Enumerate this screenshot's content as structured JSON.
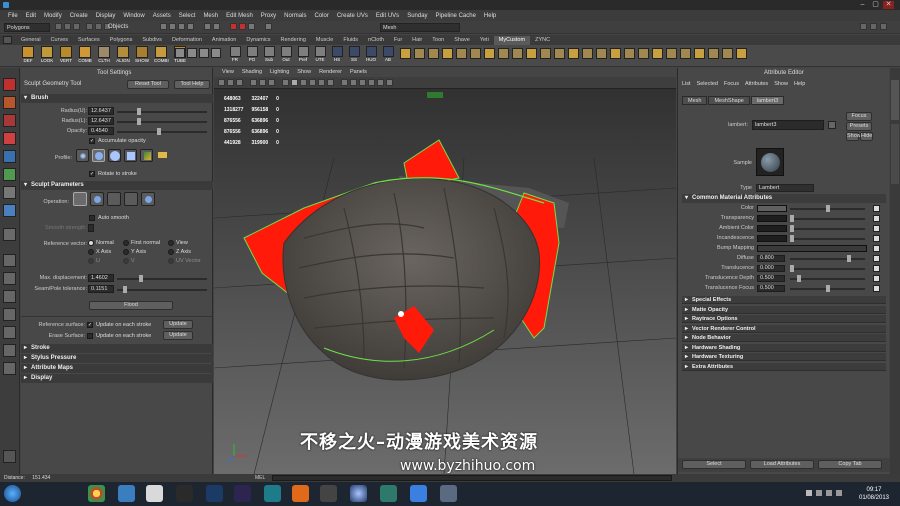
{
  "window": {
    "menus": [
      "File",
      "Edit",
      "Modify",
      "Create",
      "Display",
      "Window",
      "Assets",
      "Select",
      "Mesh",
      "Edit Mesh",
      "Proxy",
      "Normals",
      "Color",
      "Create UVs",
      "Edit UVs",
      "Sunday",
      "Pipeline Cache",
      "Help"
    ]
  },
  "statusline": {
    "mode": "Polygons",
    "objects_label": "Objects",
    "search_value": "Mesh"
  },
  "shelf": {
    "tabs": [
      "General",
      "Curves",
      "Surfaces",
      "Polygons",
      "Subdivs",
      "Deformation",
      "Animation",
      "Dynamics",
      "Rendering",
      "Muscle",
      "Fluids",
      "nCloth",
      "Fur",
      "Hair",
      "Toon",
      "Shave",
      "Yeti",
      "MyCustom",
      "ZYNC"
    ],
    "active_tab": "MyCustom",
    "left_labels": [
      "DEF",
      "LOOK",
      "VERT",
      "COMB",
      "CLTH",
      "ALIGN",
      "SHOW",
      "COMBI",
      "TUBE"
    ],
    "right_labels": [
      "FR",
      "PO",
      "Sub",
      "Out",
      "Pref",
      "UTE",
      "HS",
      "SS",
      "HUO",
      "AB"
    ]
  },
  "tool_settings": {
    "panel_title": "Tool Settings",
    "tool_name": "Sculpt Geometry Tool",
    "reset_tool": "Reset Tool",
    "tool_help": "Tool Help",
    "brush": {
      "header": "Brush",
      "radius_u_label": "Radius(U):",
      "radius_u": "12.6437",
      "radius_l_label": "Radius(L):",
      "radius_l": "12.6437",
      "opacity_label": "Opacity:",
      "opacity": "0.4540",
      "accumulate_opacity": "Accumulate opacity",
      "profile_label": "Profile:",
      "rotate_to_stroke": "Rotate to stroke"
    },
    "sculpt_parameters": {
      "header": "Sculpt Parameters",
      "operation_label": "Operation:",
      "auto_smooth": "Auto smooth",
      "smooth_strength_label": "Smooth strength:",
      "reference_vector_label": "Reference vector:",
      "options": [
        "Normal",
        "First normal",
        "View",
        "X Axis",
        "Y Axis",
        "Z Axis",
        "U",
        "V",
        "UV Vector"
      ],
      "max_displacement_label": "Max. displacement:",
      "max_displacement": "1.4602",
      "seam_pole_label": "Seam/Pole tolerance:",
      "seam_pole": "0.1151",
      "flood_label": "Flood"
    },
    "reference_surface_label": "Reference surface:",
    "erase_surface_label": "Erase Surface:",
    "update_on_each_stroke": "Update on each stroke",
    "update_button": "Update",
    "collapsed_sections": [
      "Stroke",
      "Stylus Pressure",
      "Attribute Maps",
      "Display"
    ]
  },
  "viewport": {
    "menus": [
      "View",
      "Shading",
      "Lighting",
      "Show",
      "Renderer",
      "Panels"
    ],
    "hud": [
      [
        "648063",
        "322407",
        "0"
      ],
      [
        "1318277",
        "956158",
        "0"
      ],
      [
        "876556",
        "636896",
        "0"
      ],
      [
        "876556",
        "636896",
        "0"
      ],
      [
        "441928",
        "319900",
        "0"
      ]
    ],
    "watermark_cn": "不移之火–动漫游戏美术资源",
    "watermark_url": "www.byzhihuo.com"
  },
  "attribute_editor": {
    "panel_title": "Attribute Editor",
    "menus": [
      "List",
      "Selected",
      "Focus",
      "Attributes",
      "Show",
      "Help"
    ],
    "node_tabs": [
      "Mesh",
      "MeshShape",
      "lambert3"
    ],
    "active_node_tab": "lambert3",
    "node_type_label": "lambert:",
    "node_name": "lambert3",
    "focus": "Focus",
    "presets": "Presets",
    "show": "Show",
    "hide": "Hide",
    "sample_label": "Sample",
    "type_label": "Type",
    "type_value": "Lambert",
    "common_header": "Common Material Attributes",
    "attrs": [
      {
        "label": "Color",
        "value": "",
        "slider": 0.5
      },
      {
        "label": "Transparency",
        "value": "",
        "slider": 0.0
      },
      {
        "label": "Ambient Color",
        "value": "",
        "slider": 0.0
      },
      {
        "label": "Incandescence",
        "value": "",
        "slider": 0.0
      },
      {
        "label": "Bump Mapping",
        "value": "",
        "slider": null
      },
      {
        "label": "Diffuse",
        "value": "0.800",
        "slider": 0.8
      },
      {
        "label": "Translucence",
        "value": "0.000",
        "slider": 0.0
      },
      {
        "label": "Translucence Depth",
        "value": "0.500",
        "slider": 0.1
      },
      {
        "label": "Translucence Focus",
        "value": "0.500",
        "slider": 0.5
      }
    ],
    "collapsed_sections": [
      "Special Effects",
      "Matte Opacity",
      "Raytrace Options",
      "Vector Renderer Control",
      "Node Behavior",
      "Hardware Shading",
      "Hardware Texturing",
      "Extra Attributes"
    ],
    "footer": [
      "Select",
      "Load Attributes",
      "Copy Tab"
    ]
  },
  "helpline": {
    "label": "Distance:",
    "value": "151.434",
    "mel": "MEL"
  },
  "taskbar": {
    "apps": [
      "start-orb",
      "chrome",
      "explorer",
      "nuke",
      "zbrush",
      "photoshop",
      "after-effects",
      "maya",
      "marmoset",
      "mudbox",
      "cinema4d",
      "topogun",
      "dropbox",
      "unknown"
    ],
    "time": "09:17",
    "date": "01/08/2013"
  },
  "colors": {
    "accent_red": "#ff1a0a",
    "selection_green": "#6fe04a",
    "mesh_gray": "#5e5a56",
    "active_tab": "#5a5a5a"
  }
}
